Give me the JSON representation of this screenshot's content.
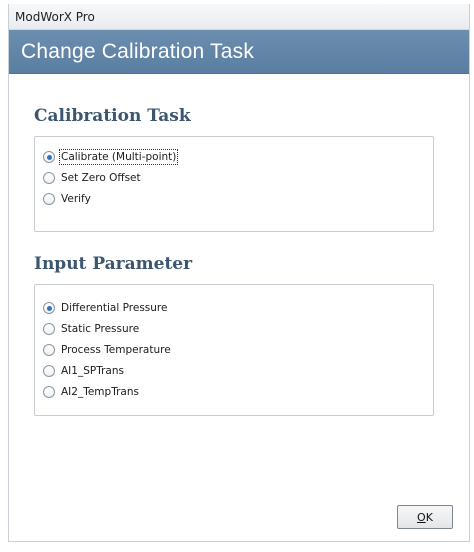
{
  "window": {
    "app_title": "ModWorX Pro",
    "header_title": "Change Calibration Task",
    "colors": {
      "header_bg": "#5e82a5",
      "heading_text": "#3c5670",
      "radio_selected": "#2e74c0"
    }
  },
  "calibration_task": {
    "heading": "Calibration Task",
    "selected": "Calibrate (Multi-point)",
    "options": [
      {
        "label": "Calibrate (Multi-point)",
        "checked": true
      },
      {
        "label": "Set Zero Offset",
        "checked": false
      },
      {
        "label": "Verify",
        "checked": false
      }
    ]
  },
  "input_parameter": {
    "heading": "Input Parameter",
    "selected": "Differential Pressure",
    "options": [
      {
        "label": "Differential Pressure",
        "checked": true
      },
      {
        "label": "Static Pressure",
        "checked": false
      },
      {
        "label": "Process Temperature",
        "checked": false
      },
      {
        "label": "AI1_SPTrans",
        "checked": false
      },
      {
        "label": "AI2_TempTrans",
        "checked": false
      }
    ]
  },
  "buttons": {
    "ok_mnemonic": "O",
    "ok_rest": "K"
  }
}
